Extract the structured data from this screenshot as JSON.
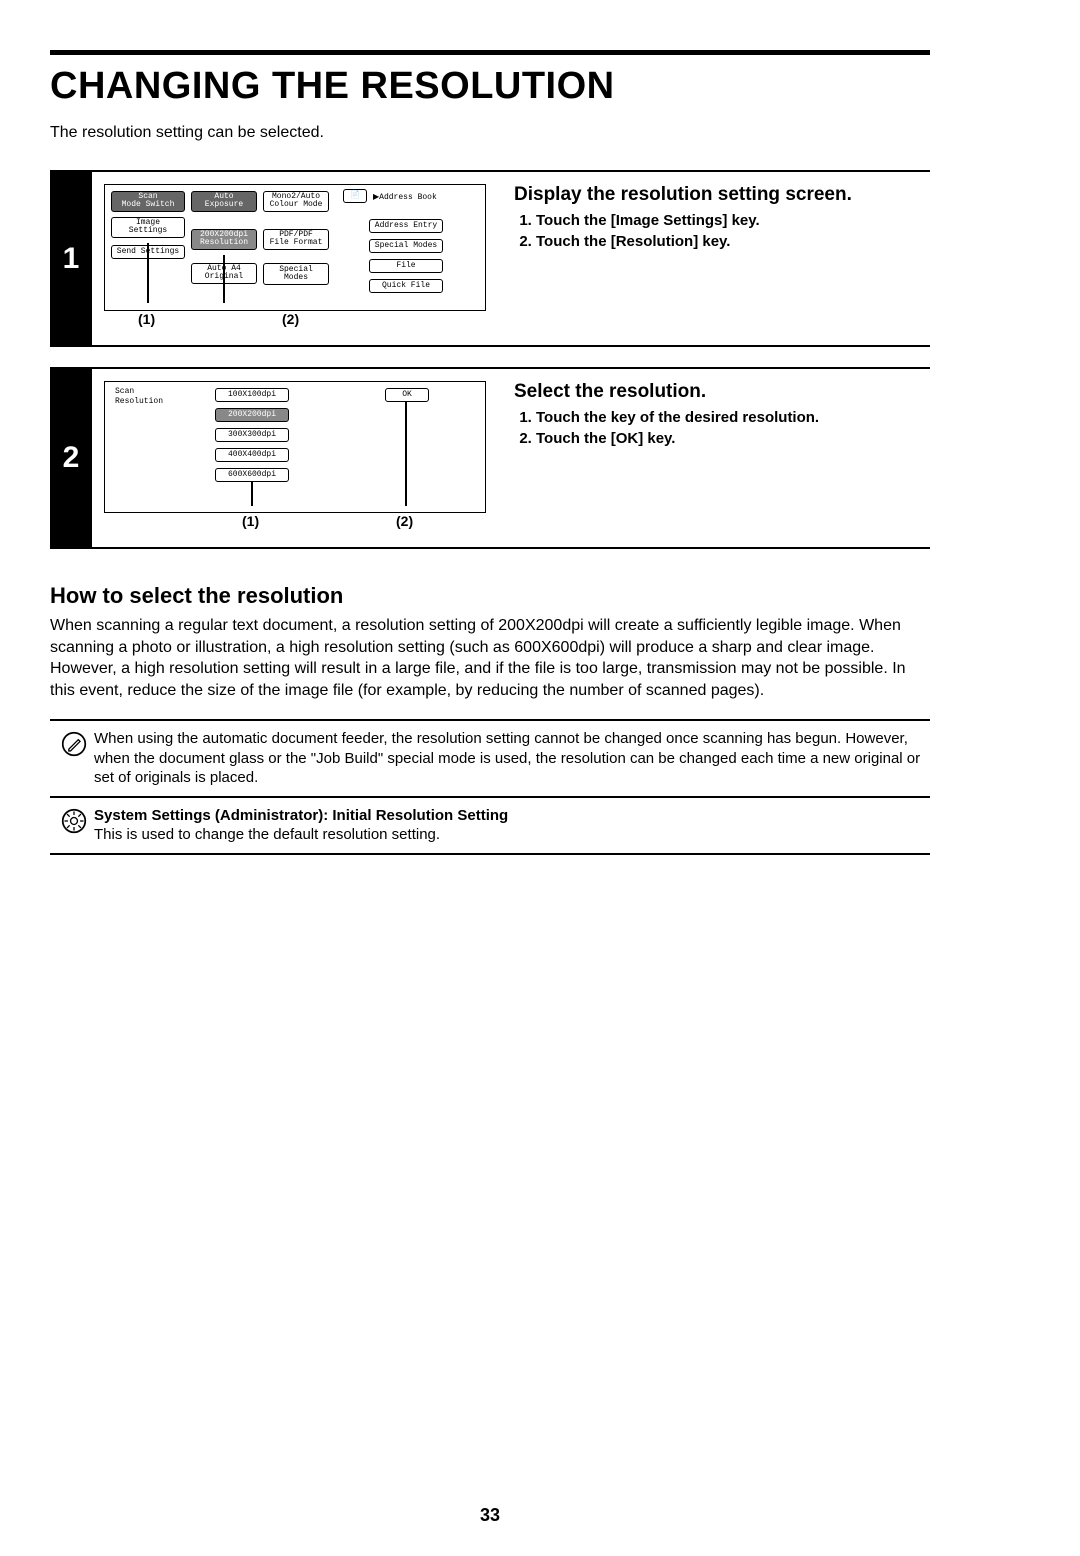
{
  "page": {
    "title": "CHANGING THE RESOLUTION",
    "intro": "The resolution setting can be selected.",
    "number": "33"
  },
  "step1": {
    "num": "1",
    "heading": "Display the resolution setting screen.",
    "item1": "Touch the [Image Settings] key.",
    "item2": "Touch the [Resolution] key.",
    "callout1": "(1)",
    "callout2": "(2)"
  },
  "step2": {
    "num": "2",
    "heading": "Select the resolution.",
    "item1": "Touch the key of the desired resolution.",
    "item2": "Touch the [OK] key.",
    "callout1": "(1)",
    "callout2": "(2)"
  },
  "lcd1": {
    "scan": "Scan",
    "mode_switch": "Mode Switch",
    "image_settings": "Image\nSettings",
    "send_settings": "Send Settings",
    "auto": "Auto",
    "exposure": "Exposure",
    "val_200": "200X200dpi",
    "resolution": "Resolution",
    "auto_a4": "Auto    A4",
    "original": "Original",
    "mono2_auto": "Mono2/Auto",
    "colour_mode": "Colour Mode",
    "pdf_pdf": "PDF/PDF",
    "file_format": "File Format",
    "special_modes": "Special Modes",
    "address_book": "Address Book",
    "address_entry": "Address Entry",
    "special_modes2": "Special Modes",
    "file": "File",
    "quick_file": "Quick File"
  },
  "lcd2": {
    "scan": "Scan",
    "resolution": "Resolution",
    "r100": "100X100dpi",
    "r200": "200X200dpi",
    "r300": "300X300dpi",
    "r400": "400X400dpi",
    "r600": "600X600dpi",
    "ok": "OK"
  },
  "howto": {
    "heading": "How to select the resolution",
    "para": "When scanning a regular text document, a resolution setting of 200X200dpi will create a sufficiently legible image. When scanning a photo or illustration, a high resolution setting (such as 600X600dpi) will produce a sharp and clear image. However, a high resolution setting will result in a large file, and if the file is too large, transmission may not be possible. In this event, reduce the size of the image file (for example, by reducing the number of scanned pages)."
  },
  "note1": {
    "text": "When using the automatic document feeder, the resolution setting cannot be changed once scanning has begun. However, when the document glass or the \"Job Build\" special mode is used, the resolution can be changed each time a new original or set of originals is placed."
  },
  "note2": {
    "title": "System Settings (Administrator): Initial Resolution Setting",
    "text": "This is used to change the default resolution setting."
  }
}
